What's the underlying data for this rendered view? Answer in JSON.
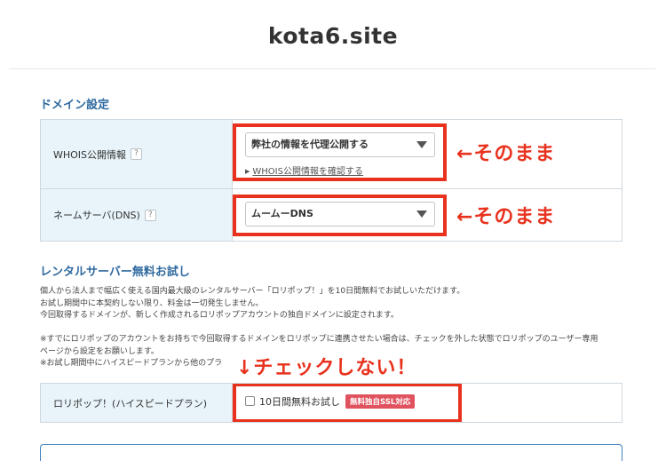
{
  "header": {
    "domain": "kota6.site"
  },
  "domain_settings": {
    "title": "ドメイン設定",
    "whois": {
      "label": "WHOIS公開情報",
      "help": "?",
      "selected": "弊社の情報を代理公開する",
      "link": "WHOIS公開情報を確認する"
    },
    "nameserver": {
      "label": "ネームサーバ(DNS)",
      "help": "?",
      "selected": "ムームーDNS"
    }
  },
  "rental": {
    "title": "レンタルサーバー無料お試し",
    "description_lines": [
      "個人から法人まで幅広く使える国内最大級のレンタルサーバー「ロリポップ！」を10日間無料でお試しいただけます。",
      "お試し期間中に本契約しない限り、料金は一切発生しません。",
      "今回取得するドメインが、新しく作成されるロリポップアカウントの独自ドメインに設定されます。"
    ],
    "notes": [
      "※すでにロリポップのアカウントをお持ちで今回取得するドメインをロリポップに連携させたい場合は、チェックを外した状態でロリポップのユーザー専用",
      "ページから設定をお願いします。",
      "※お試し期間中にハイスピードプランから他のプラ"
    ],
    "plan_label": "ロリポップ！(ハイスピードプラン)",
    "trial_checkbox_label": "10日間無料お試し",
    "trial_checked": false,
    "ssl_badge": "無料独自SSL対応"
  },
  "annotations": {
    "whois_note": "←そのまま",
    "dns_note": "←そのまま",
    "checkbox_note": "↓チェックしない！",
    "color": "#e8321e"
  }
}
